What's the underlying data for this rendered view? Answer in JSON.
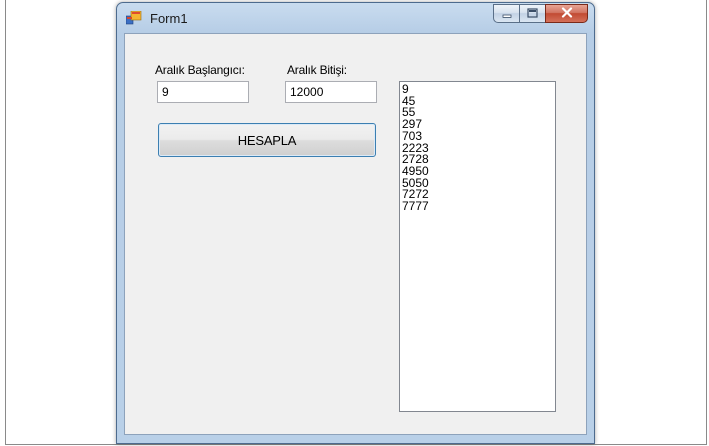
{
  "window": {
    "title": "Form1",
    "icon": "winforms-app-icon",
    "caption_buttons": {
      "minimize": "minimize-icon",
      "maximize": "maximize-icon",
      "close": "close-icon"
    }
  },
  "form": {
    "start_label": "Aralık Başlangıcı:",
    "start_value": "9",
    "end_label": "Aralık Bitişi:",
    "end_value": "12000",
    "calculate_button": "HESAPLA",
    "results": [
      "9",
      "45",
      "55",
      "297",
      "703",
      "2223",
      "2728",
      "4950",
      "5050",
      "7272",
      "7777"
    ]
  },
  "colors": {
    "frame": "#b9d0e8",
    "client": "#f0f0f0",
    "button_border": "#3c7fb1",
    "close_button": "#c24a32"
  }
}
